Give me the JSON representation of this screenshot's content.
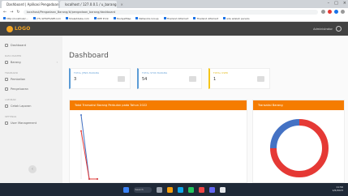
{
  "browser": {
    "tabs": [
      {
        "label": "Dashboard | Aplikasi Pengadaan",
        "active": true
      },
      {
        "label": "localhost / 127.0.0.1 / u_barang",
        "active": false
      }
    ],
    "url": "localhost/Pengadaan_Barang/#/pengadaan_barang/dashboard",
    "bookmarks": [
      "http://localhost/...",
      "(75) WHATSAPP.com",
      "Shaladdabs.com",
      "DPE Print",
      "StudyalMap",
      "Networks Group",
      "Thailand Alfamart",
      "Thailand Alfamart",
      "ada adalah penulis"
    ]
  },
  "header": {
    "logo_text": "LOGO",
    "username": "Administrator"
  },
  "sidebar": {
    "items": [
      {
        "label": "Dashboard",
        "section": ""
      },
      {
        "label": "Barang",
        "section": "DATA MASTER"
      },
      {
        "label": "Pembelian",
        "section": "TRANSAKSI"
      },
      {
        "label": "Pengeluaran",
        "section": ""
      },
      {
        "label": "Cetak Laporan",
        "section": "LAPORAN"
      },
      {
        "label": "User Management",
        "section": "SETTINGS"
      }
    ],
    "collapse_glyph": "‹"
  },
  "main": {
    "title": "Dashboard",
    "cards": [
      {
        "label": "TOTAL JENIS BARANG",
        "value": "3"
      },
      {
        "label": "TOTAL STOK BARANG",
        "value": "54"
      },
      {
        "label": "TOTAL USER",
        "value": "1"
      }
    ],
    "transaksi_chart_title": "Total Transaksi Barang Perbulan pada Tahun 2022",
    "pie_chart_title": "Transaksi Barang"
  },
  "chart_data": [
    {
      "type": "line",
      "title": "Total Transaksi Barang Perbulan pada Tahun 2022",
      "categories": [
        "1",
        "2",
        "3"
      ],
      "series": [
        {
          "values": [
            4,
            0,
            0
          ],
          "color": "#4472c4"
        },
        {
          "values": [
            3,
            0,
            0
          ],
          "color": "#e53935"
        }
      ],
      "ylim": [
        0,
        4
      ]
    },
    {
      "type": "pie",
      "title": "Transaksi Barang",
      "slices": [
        {
          "value": 75,
          "color": "#e53935"
        },
        {
          "value": 25,
          "color": "#4472c4"
        }
      ]
    }
  ],
  "taskbar": {
    "search_label": "Search",
    "time": "11:56",
    "date": "1/6/2023",
    "lang": "ENG"
  },
  "colors": {
    "accent": "#f57c00",
    "header_bg": "#424242",
    "logo": "#f5a623"
  }
}
